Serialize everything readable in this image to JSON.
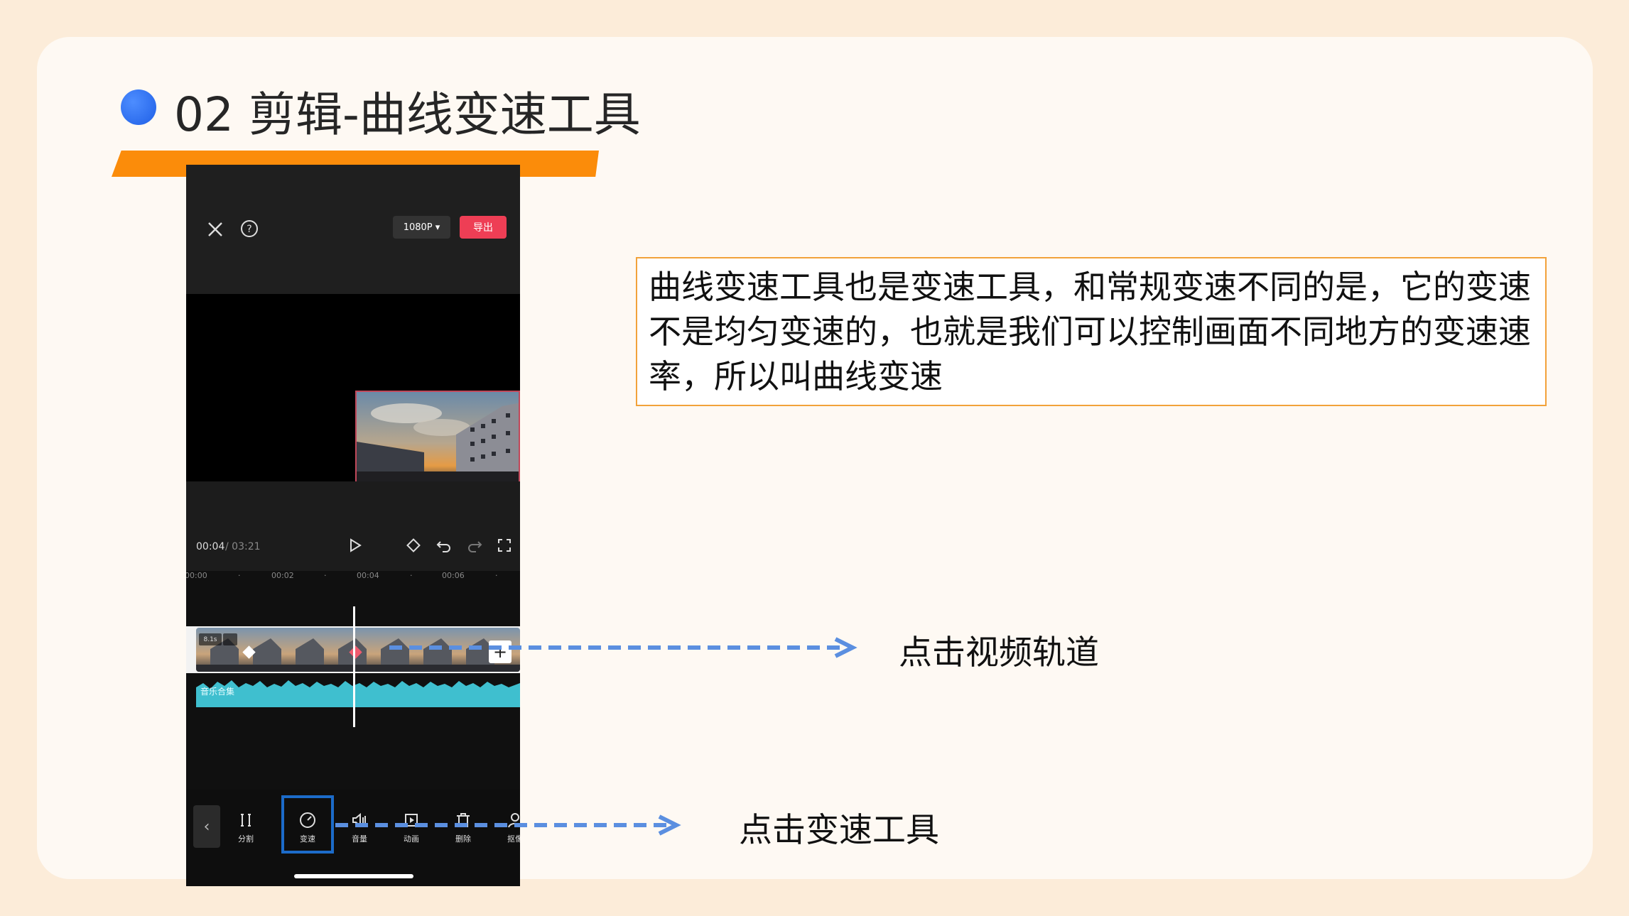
{
  "slide": {
    "title": "02 剪辑-曲线变速工具",
    "description": "曲线变速工具也是变速工具，和常规变速不同的是，它的变速不是均匀变速的，也就是我们可以控制画面不同地方的变速速率，所以叫曲线变速",
    "annotation_track": "点击视频轨道",
    "annotation_speed": "点击变速工具"
  },
  "app": {
    "resolution_label": "1080P ▾",
    "export_label": "导出",
    "time_current": "00:04",
    "time_total": "/ 03:21",
    "ruler": [
      "00:00",
      "00:02",
      "00:04",
      "00:06"
    ],
    "clip_speed": "8.1s",
    "audio_label": "音乐合集",
    "tools": [
      "分割",
      "变速",
      "音量",
      "动画",
      "删除",
      "抠像"
    ]
  },
  "colors": {
    "accent_orange": "#fb8c0a",
    "bullet_blue": "#2f6ff0",
    "export_red": "#ee3e55",
    "selection_blue": "#1c6bc9",
    "arrow_blue": "#5b8fe0",
    "audio_cyan": "#3fbfcf"
  }
}
